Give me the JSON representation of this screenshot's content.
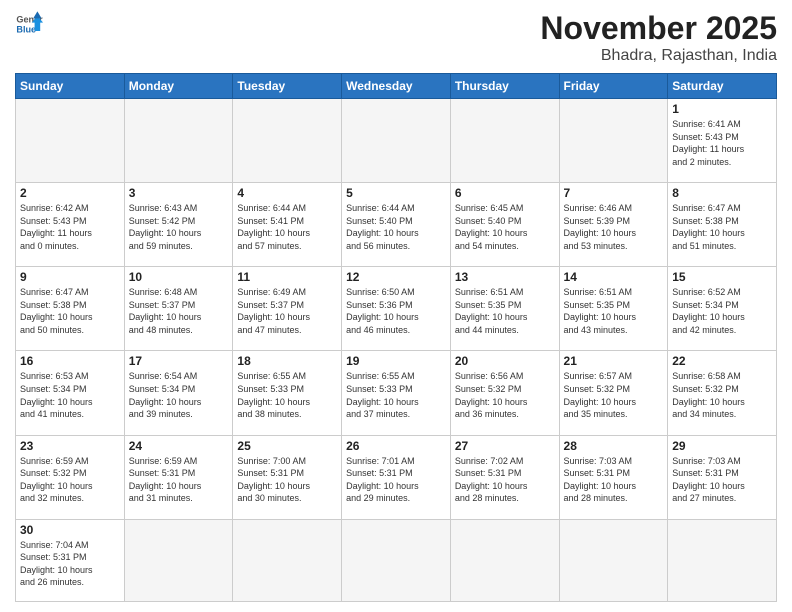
{
  "header": {
    "logo_general": "General",
    "logo_blue": "Blue",
    "month_title": "November 2025",
    "location": "Bhadra, Rajasthan, India"
  },
  "weekdays": [
    "Sunday",
    "Monday",
    "Tuesday",
    "Wednesday",
    "Thursday",
    "Friday",
    "Saturday"
  ],
  "weeks": [
    [
      {
        "day": "",
        "info": ""
      },
      {
        "day": "",
        "info": ""
      },
      {
        "day": "",
        "info": ""
      },
      {
        "day": "",
        "info": ""
      },
      {
        "day": "",
        "info": ""
      },
      {
        "day": "",
        "info": ""
      },
      {
        "day": "1",
        "info": "Sunrise: 6:41 AM\nSunset: 5:43 PM\nDaylight: 11 hours\nand 2 minutes."
      }
    ],
    [
      {
        "day": "2",
        "info": "Sunrise: 6:42 AM\nSunset: 5:43 PM\nDaylight: 11 hours\nand 0 minutes."
      },
      {
        "day": "3",
        "info": "Sunrise: 6:43 AM\nSunset: 5:42 PM\nDaylight: 10 hours\nand 59 minutes."
      },
      {
        "day": "4",
        "info": "Sunrise: 6:44 AM\nSunset: 5:41 PM\nDaylight: 10 hours\nand 57 minutes."
      },
      {
        "day": "5",
        "info": "Sunrise: 6:44 AM\nSunset: 5:40 PM\nDaylight: 10 hours\nand 56 minutes."
      },
      {
        "day": "6",
        "info": "Sunrise: 6:45 AM\nSunset: 5:40 PM\nDaylight: 10 hours\nand 54 minutes."
      },
      {
        "day": "7",
        "info": "Sunrise: 6:46 AM\nSunset: 5:39 PM\nDaylight: 10 hours\nand 53 minutes."
      },
      {
        "day": "8",
        "info": "Sunrise: 6:47 AM\nSunset: 5:38 PM\nDaylight: 10 hours\nand 51 minutes."
      }
    ],
    [
      {
        "day": "9",
        "info": "Sunrise: 6:47 AM\nSunset: 5:38 PM\nDaylight: 10 hours\nand 50 minutes."
      },
      {
        "day": "10",
        "info": "Sunrise: 6:48 AM\nSunset: 5:37 PM\nDaylight: 10 hours\nand 48 minutes."
      },
      {
        "day": "11",
        "info": "Sunrise: 6:49 AM\nSunset: 5:37 PM\nDaylight: 10 hours\nand 47 minutes."
      },
      {
        "day": "12",
        "info": "Sunrise: 6:50 AM\nSunset: 5:36 PM\nDaylight: 10 hours\nand 46 minutes."
      },
      {
        "day": "13",
        "info": "Sunrise: 6:51 AM\nSunset: 5:35 PM\nDaylight: 10 hours\nand 44 minutes."
      },
      {
        "day": "14",
        "info": "Sunrise: 6:51 AM\nSunset: 5:35 PM\nDaylight: 10 hours\nand 43 minutes."
      },
      {
        "day": "15",
        "info": "Sunrise: 6:52 AM\nSunset: 5:34 PM\nDaylight: 10 hours\nand 42 minutes."
      }
    ],
    [
      {
        "day": "16",
        "info": "Sunrise: 6:53 AM\nSunset: 5:34 PM\nDaylight: 10 hours\nand 41 minutes."
      },
      {
        "day": "17",
        "info": "Sunrise: 6:54 AM\nSunset: 5:34 PM\nDaylight: 10 hours\nand 39 minutes."
      },
      {
        "day": "18",
        "info": "Sunrise: 6:55 AM\nSunset: 5:33 PM\nDaylight: 10 hours\nand 38 minutes."
      },
      {
        "day": "19",
        "info": "Sunrise: 6:55 AM\nSunset: 5:33 PM\nDaylight: 10 hours\nand 37 minutes."
      },
      {
        "day": "20",
        "info": "Sunrise: 6:56 AM\nSunset: 5:32 PM\nDaylight: 10 hours\nand 36 minutes."
      },
      {
        "day": "21",
        "info": "Sunrise: 6:57 AM\nSunset: 5:32 PM\nDaylight: 10 hours\nand 35 minutes."
      },
      {
        "day": "22",
        "info": "Sunrise: 6:58 AM\nSunset: 5:32 PM\nDaylight: 10 hours\nand 34 minutes."
      }
    ],
    [
      {
        "day": "23",
        "info": "Sunrise: 6:59 AM\nSunset: 5:32 PM\nDaylight: 10 hours\nand 32 minutes."
      },
      {
        "day": "24",
        "info": "Sunrise: 6:59 AM\nSunset: 5:31 PM\nDaylight: 10 hours\nand 31 minutes."
      },
      {
        "day": "25",
        "info": "Sunrise: 7:00 AM\nSunset: 5:31 PM\nDaylight: 10 hours\nand 30 minutes."
      },
      {
        "day": "26",
        "info": "Sunrise: 7:01 AM\nSunset: 5:31 PM\nDaylight: 10 hours\nand 29 minutes."
      },
      {
        "day": "27",
        "info": "Sunrise: 7:02 AM\nSunset: 5:31 PM\nDaylight: 10 hours\nand 28 minutes."
      },
      {
        "day": "28",
        "info": "Sunrise: 7:03 AM\nSunset: 5:31 PM\nDaylight: 10 hours\nand 28 minutes."
      },
      {
        "day": "29",
        "info": "Sunrise: 7:03 AM\nSunset: 5:31 PM\nDaylight: 10 hours\nand 27 minutes."
      }
    ],
    [
      {
        "day": "30",
        "info": "Sunrise: 7:04 AM\nSunset: 5:31 PM\nDaylight: 10 hours\nand 26 minutes."
      },
      {
        "day": "",
        "info": ""
      },
      {
        "day": "",
        "info": ""
      },
      {
        "day": "",
        "info": ""
      },
      {
        "day": "",
        "info": ""
      },
      {
        "day": "",
        "info": ""
      },
      {
        "day": "",
        "info": ""
      }
    ]
  ]
}
